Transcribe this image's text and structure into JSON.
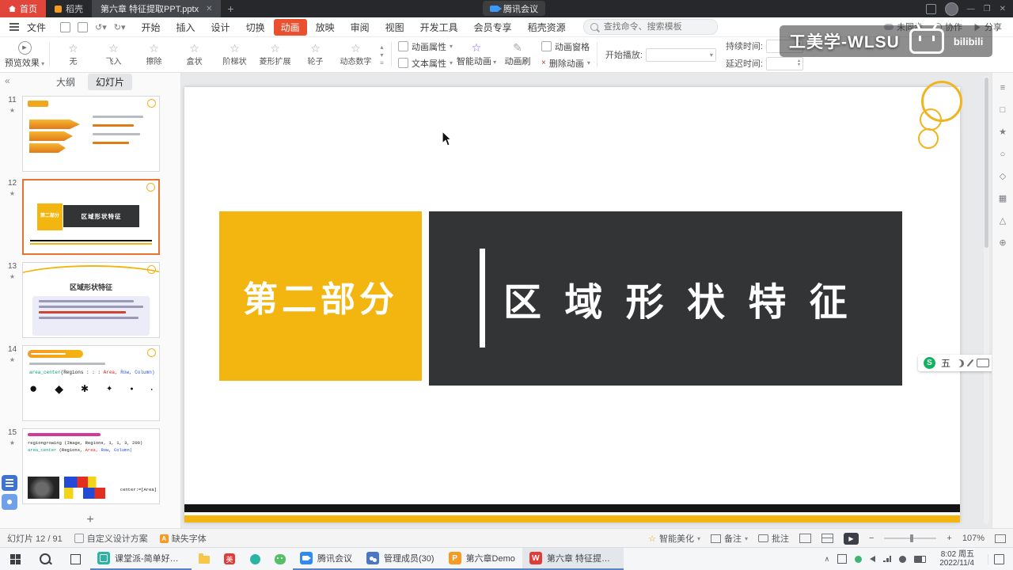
{
  "colors": {
    "active_tab": "#e8502f",
    "slide_yellow": "#f3b50f",
    "slide_dark": "#333436",
    "thumb_selected": "#e8722e"
  },
  "titlebar": {
    "home_tab": "首页",
    "docer_tab": "稻壳",
    "doc_tab": "第六章 特征提取PPT.pptx",
    "meeting_pill": "腾讯会议"
  },
  "watermark": {
    "text": "工美学-WLSU",
    "logo": "bilibili"
  },
  "menubar": {
    "file": "文件",
    "items": [
      "开始",
      "插入",
      "设计",
      "切换",
      "动画",
      "放映",
      "审阅",
      "视图",
      "开发工具",
      "会员专享",
      "稻壳资源"
    ],
    "search_placeholder": "查找命令、搜索模板",
    "sync": "未同步",
    "collab": "协作",
    "share": "分享"
  },
  "ribbon": {
    "preview": "预览效果",
    "gallery": [
      "无",
      "飞入",
      "擦除",
      "盒状",
      "阶梯状",
      "菱形扩展",
      "轮子",
      "动态数字"
    ],
    "anim_props": "动画属性",
    "text_props": "文本属性",
    "smart_anim": "智能动画",
    "anim_pane": "动画窗格",
    "anim_brush": "动画刷",
    "delete_anim": "删除动画",
    "start_label": "开始播放:",
    "duration_label": "持续时间:",
    "delay_label": "延迟时间:"
  },
  "sidebar": {
    "tab_outline": "大纲",
    "tab_slides": "幻灯片",
    "slides": [
      {
        "num": "11"
      },
      {
        "num": "12",
        "part": "第二部分",
        "title": "区域形状特征"
      },
      {
        "num": "13",
        "title": "区域形状特征"
      },
      {
        "num": "14",
        "fn": "area_center",
        "args": "(Regions : : : ",
        "arg_area": "Area,",
        "arg_rest": " Row, Column)"
      },
      {
        "num": "15",
        "code1": "regiongrowing (Image, Regions, 1, 1, 3, 200)",
        "fn": "area_center",
        "args": " (Regions, ",
        "arg_area": "Area,",
        "arg_rest": " Row, Column)",
        "code3": "center:=[Area]"
      }
    ]
  },
  "slide": {
    "part_label": "第二部分",
    "title": "区 域 形 状 特 征"
  },
  "ime": {
    "mode": "五"
  },
  "statusbar": {
    "slide_indicator": "幻灯片 12 / 91",
    "design_scheme": "自定义设计方案",
    "missing_font": "缺失字体",
    "beautify": "智能美化",
    "notes": "备注",
    "comments": "批注",
    "zoom": "107%"
  },
  "taskbar": {
    "apps": [
      {
        "label": "课堂派-简单好用的..."
      },
      {
        "label": "腾讯会议"
      },
      {
        "label": "管理成员(30)"
      },
      {
        "label": "第六章Demo"
      },
      {
        "label": "第六章 特征提取PP..."
      }
    ],
    "time": "8:02 周五",
    "date": "2022/11/4"
  }
}
